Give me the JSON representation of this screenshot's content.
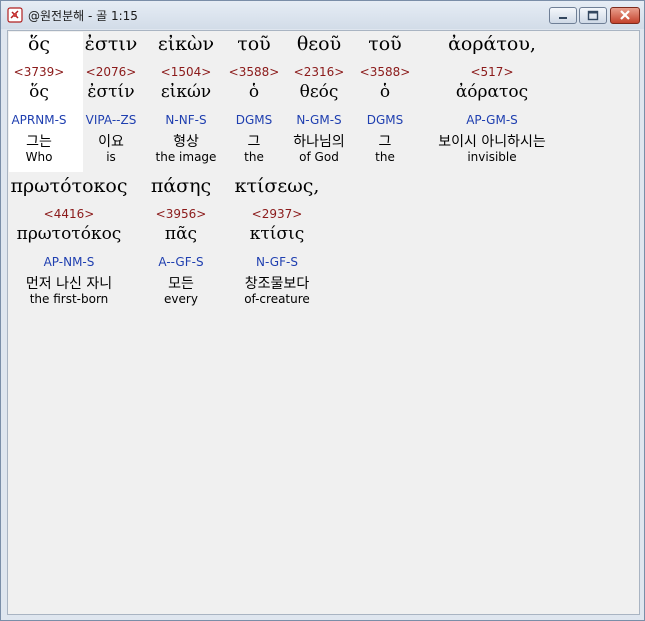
{
  "window": {
    "title": "@원전분해 - 골 1:15",
    "icon": "app-logo-icon",
    "controls": {
      "minimize": "minimize-icon",
      "maximize": "maximize-icon",
      "close": "close-icon"
    }
  },
  "lines": [
    {
      "words": [
        {
          "greek": "ὅς",
          "strong": "<3739>",
          "lemma": "ὅς",
          "morph": "APRNM-S",
          "korean": "그는",
          "english": "Who"
        },
        {
          "greek": "ἐστιν",
          "strong": "<2076>",
          "lemma": "ἐστίν",
          "morph": "VIPA--ZS",
          "korean": "이요",
          "english": "is"
        },
        {
          "greek": "εἰκὼν",
          "strong": "<1504>",
          "lemma": "εἰκών",
          "morph": "N-NF-S",
          "korean": "형상",
          "english": "the image"
        },
        {
          "greek": "τοῦ",
          "strong": "<3588>",
          "lemma": "ὁ",
          "morph": "DGMS",
          "korean": "그",
          "english": "the"
        },
        {
          "greek": "θεοῦ",
          "strong": "<2316>",
          "lemma": "θεός",
          "morph": "N-GM-S",
          "korean": "하나님의",
          "english": "of God"
        },
        {
          "greek": "τοῦ",
          "strong": "<3588>",
          "lemma": "ὁ",
          "morph": "DGMS",
          "korean": "그",
          "english": "the"
        },
        {
          "greek": "ἀοράτου,",
          "strong": "<517>",
          "lemma": "ἀόρατος",
          "morph": "AP-GM-S",
          "korean": "보이시 아니하시는",
          "english": "invisible"
        }
      ]
    },
    {
      "words": [
        {
          "greek": "πρωτότοκος",
          "strong": "<4416>",
          "lemma": "πρωτοτόκος",
          "morph": "AP-NM-S",
          "korean": "먼저 나신 자니",
          "english": "the first-born"
        },
        {
          "greek": "πάσης",
          "strong": "<3956>",
          "lemma": "πᾶς",
          "morph": "A--GF-S",
          "korean": "모든",
          "english": "every"
        },
        {
          "greek": "κτίσεως,",
          "strong": "<2937>",
          "lemma": "κτίσις",
          "morph": "N-GF-S",
          "korean": "창조물보다",
          "english": "of-creature"
        }
      ]
    }
  ]
}
